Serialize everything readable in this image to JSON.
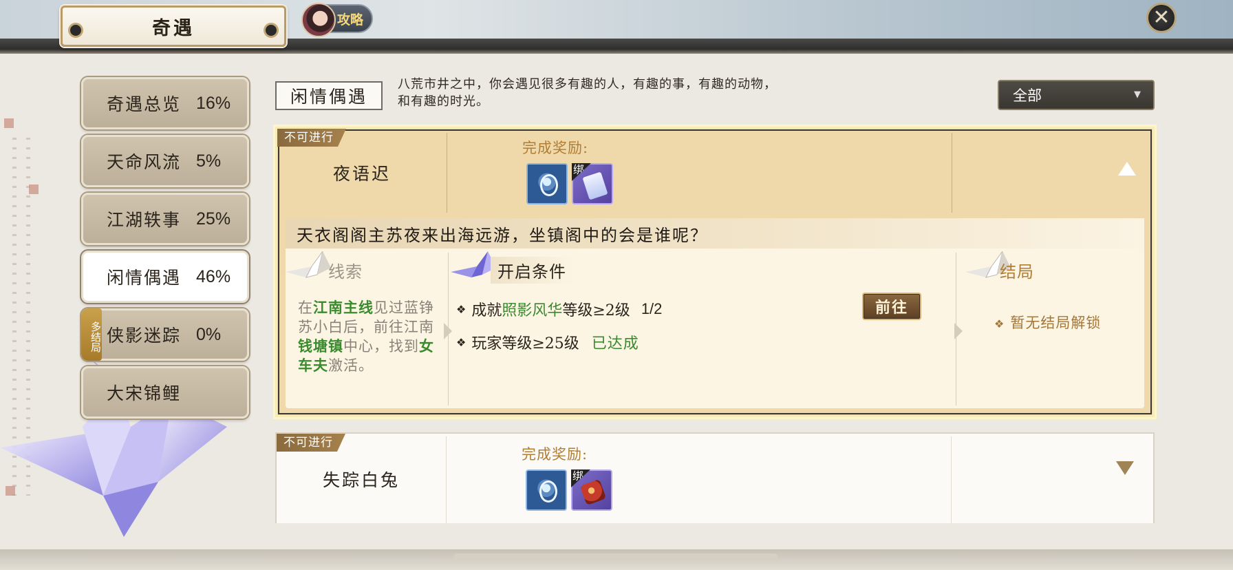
{
  "window": {
    "title": "奇遇",
    "guide_label": "攻略",
    "close_symbol": "✕"
  },
  "sidebar": {
    "items": [
      {
        "label": "奇遇总览",
        "percent": "16%",
        "active": false
      },
      {
        "label": "天命风流",
        "percent": "5%",
        "active": false
      },
      {
        "label": "江湖轶事",
        "percent": "25%",
        "active": false
      },
      {
        "label": "闲情偶遇",
        "percent": "46%",
        "active": true
      },
      {
        "label": "侠影迷踪",
        "percent": "0%",
        "active": false
      },
      {
        "label": "大宋锦鲤",
        "percent": "",
        "active": false
      }
    ],
    "multi_ending_badge": "多结局"
  },
  "header": {
    "category_title": "闲情偶遇",
    "description_line1": "八荒市井之中，你会遇见很多有趣的人，有趣的事，有趣的动物，",
    "description_line2": "和有趣的时光。",
    "filter_value": "全部",
    "filter_arrow": "▼"
  },
  "encounters": [
    {
      "status": "不可进行",
      "name": "夜语迟",
      "reward_label": "完成奖励:",
      "rewards": [
        {
          "icon": "jade-pendant-icon",
          "bound": false
        },
        {
          "icon": "scroll-icon",
          "bound": true,
          "bound_label": "绑"
        }
      ],
      "expanded": true,
      "story": "天衣阁阁主苏夜来出海远游，坐镇阁中的会是谁呢？",
      "clue": {
        "title": "线索",
        "parts": [
          "在",
          "江南主线",
          "见过蓝铮苏小白后，前往江南",
          "钱塘镇",
          "中心，找到",
          "女车夫",
          "激活。"
        ]
      },
      "conditions": {
        "title": "开启条件",
        "items": [
          {
            "prefix": "成就",
            "highlight": "照影风华",
            "suffix": "等级≥2级",
            "progress": "1/2",
            "action": "前往"
          },
          {
            "text": "玩家等级≥25级",
            "status": "已达成"
          }
        ]
      },
      "ending": {
        "title": "结局",
        "text": "暂无结局解锁"
      }
    },
    {
      "status": "不可进行",
      "name": "失踪白兔",
      "reward_label": "完成奖励:",
      "rewards": [
        {
          "icon": "jade-pendant-icon",
          "bound": false
        },
        {
          "icon": "red-pouch-icon",
          "bound": true,
          "bound_label": "绑"
        }
      ],
      "expanded": false
    }
  ],
  "colors": {
    "accent_gold": "#b07d35",
    "highlight_green": "#3a8a2e",
    "panel_beige": "#efd9ab"
  }
}
